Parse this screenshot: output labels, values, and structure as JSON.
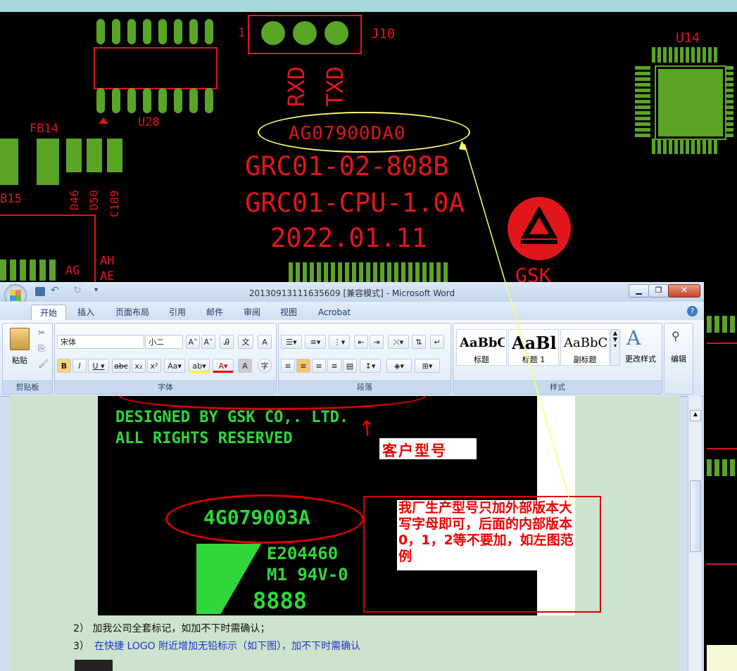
{
  "pcb": {
    "labels": {
      "j10": "J10",
      "j10_pin1": "1",
      "rxd": "RXD",
      "txd": "TXD",
      "u14": "U14",
      "u28": "U28",
      "fb14": "FB14",
      "b15": "B15",
      "d46": "D46",
      "d50": "D50",
      "c189": "C189",
      "ah": "AH",
      "ae": "AE",
      "ag": "AG",
      "part_code": "AG07900DA0",
      "line1": "GRC01-02-808B",
      "line2": "GRC01-CPU-1.0A",
      "line3": "2022.01.11",
      "gsk": "GSK"
    }
  },
  "word": {
    "title": "20130913111635609 [兼容模式] - Microsoft Word",
    "tabs": [
      "开始",
      "插入",
      "页面布局",
      "引用",
      "邮件",
      "审阅",
      "视图",
      "Acrobat"
    ],
    "active_tab": "开始",
    "ribbon": {
      "clipboard": {
        "paste": "粘贴",
        "label": "剪贴板"
      },
      "font": {
        "name": "宋体",
        "size": "小二",
        "label": "字体",
        "aa": "Aa"
      },
      "paragraph": {
        "label": "段落"
      },
      "styles": {
        "items": [
          {
            "preview": "AaBbC",
            "name": "标题"
          },
          {
            "preview": "AaBl",
            "name": "标题 1"
          },
          {
            "preview": "AaBbC",
            "name": "副标题"
          }
        ],
        "change": "更改样式",
        "label": "样式"
      },
      "editing": {
        "label": "编辑"
      }
    },
    "doc": {
      "image": {
        "line1": "DESIGNED BY GSK CO,. LTD.",
        "line2": "ALL RIGHTS RESERVED",
        "customer_model": "客户型号",
        "code": "4G079003A",
        "cert1": "E204460",
        "cert2": "M1 94V-0",
        "num": "8888",
        "note": "我厂生产型号只加外部版本大写字母即可，后面的内部版本0，1，2等不要加，如左图范例"
      },
      "item2": "2）  加我公司全套标记，如加不下时需确认；",
      "item3_num": "3）",
      "item3": "在快捷 LOGO 附近增加无铅标示（如下图），加不下时需确认"
    }
  },
  "colors": {
    "silk": "#e0161b",
    "copper": "#5aa426",
    "annotation": "#ffff66",
    "doc_bg": "#cde3cd"
  }
}
